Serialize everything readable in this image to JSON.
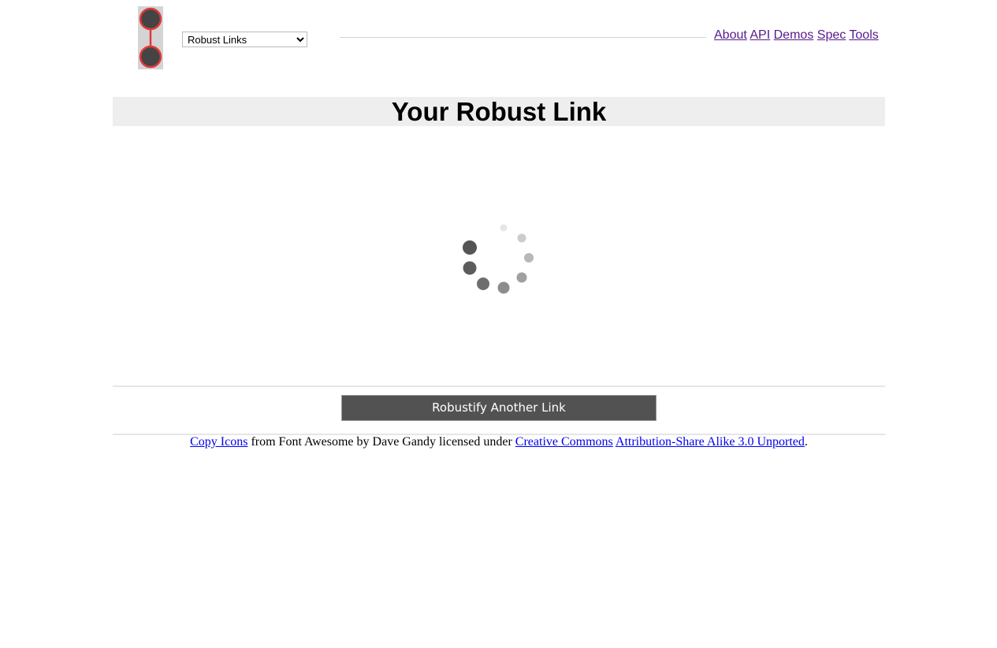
{
  "header": {
    "logo_icon": "robust-links-logo-icon",
    "site_select": {
      "selected": "Robust Links",
      "options": [
        "Robust Links"
      ]
    },
    "nav": [
      {
        "label": "About"
      },
      {
        "label": "API"
      },
      {
        "label": "Demos"
      },
      {
        "label": "Spec"
      },
      {
        "label": "Tools"
      }
    ]
  },
  "main": {
    "title": "Your Robust Link",
    "loading_icon": "loading-spinner-icon",
    "robustify_button": "Robustify Another Link"
  },
  "footer": {
    "copy_icons_link": "Copy Icons",
    "text_1": " from Font Awesome by Dave Gandy licensed under ",
    "cc_link": "Creative Commons",
    "text_2": " ",
    "license_link": "Attribution-Share Alike 3.0 Unported",
    "text_3": "."
  },
  "colors": {
    "link_visited": "#551a8b",
    "link": "#0000ee",
    "title_bar_bg": "#eeeeee",
    "button_bg": "#525252",
    "logo_ring": "#e03a3a",
    "logo_fill": "#444444"
  }
}
